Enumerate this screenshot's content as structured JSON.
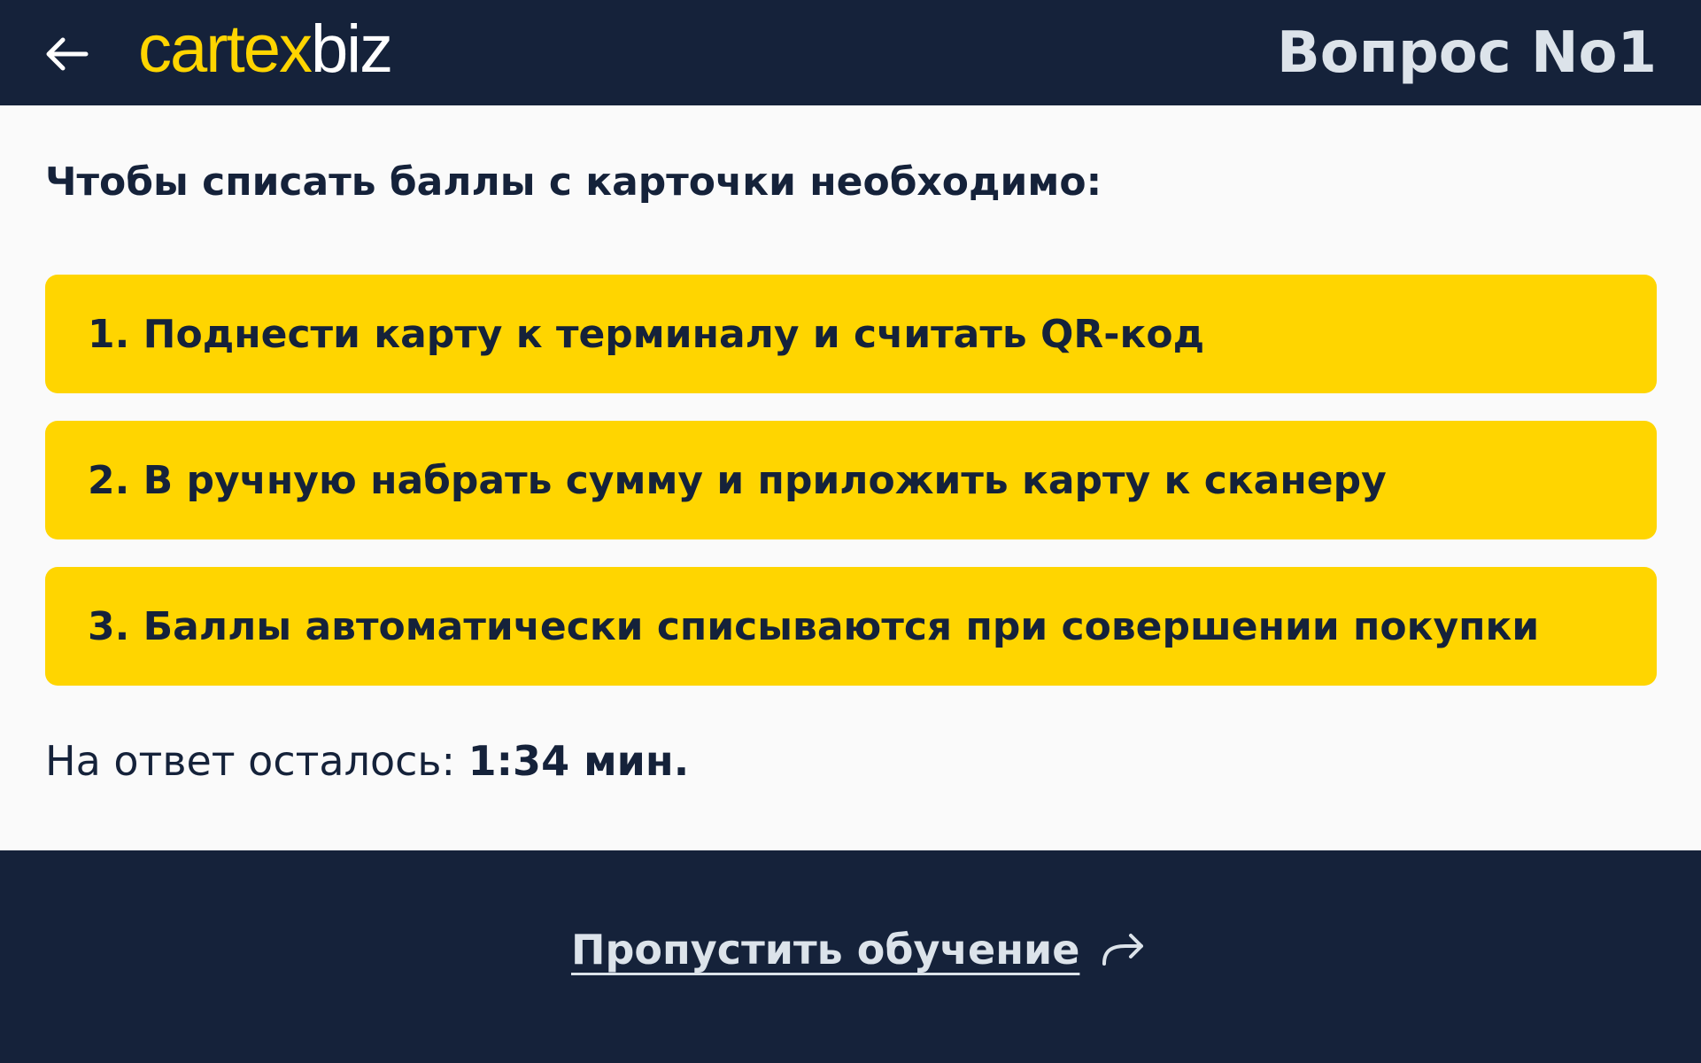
{
  "header": {
    "logo_part1": "cartex",
    "logo_part2": "biz",
    "question_title": "Вопрос No1"
  },
  "main": {
    "prompt": "Чтобы списать баллы с карточки необходимо:",
    "answers": [
      "1. Поднести карту к терминалу и считать QR-код",
      "2. В ручную набрать сумму и приложить карту к сканеру",
      "3. Баллы автоматически списываются при совершении покупки"
    ],
    "timer_label": "На ответ осталось: ",
    "timer_value": "1:34 мин."
  },
  "footer": {
    "skip_label": "Пропустить обучение"
  },
  "colors": {
    "header_bg": "#15223A",
    "accent": "#FFD500",
    "page_bg": "#FAFAFA",
    "text_dark": "#15223A",
    "text_light": "#DCE3EA"
  },
  "icons": {
    "back": "arrow-left-icon",
    "skip": "redirect-arrow-icon"
  }
}
